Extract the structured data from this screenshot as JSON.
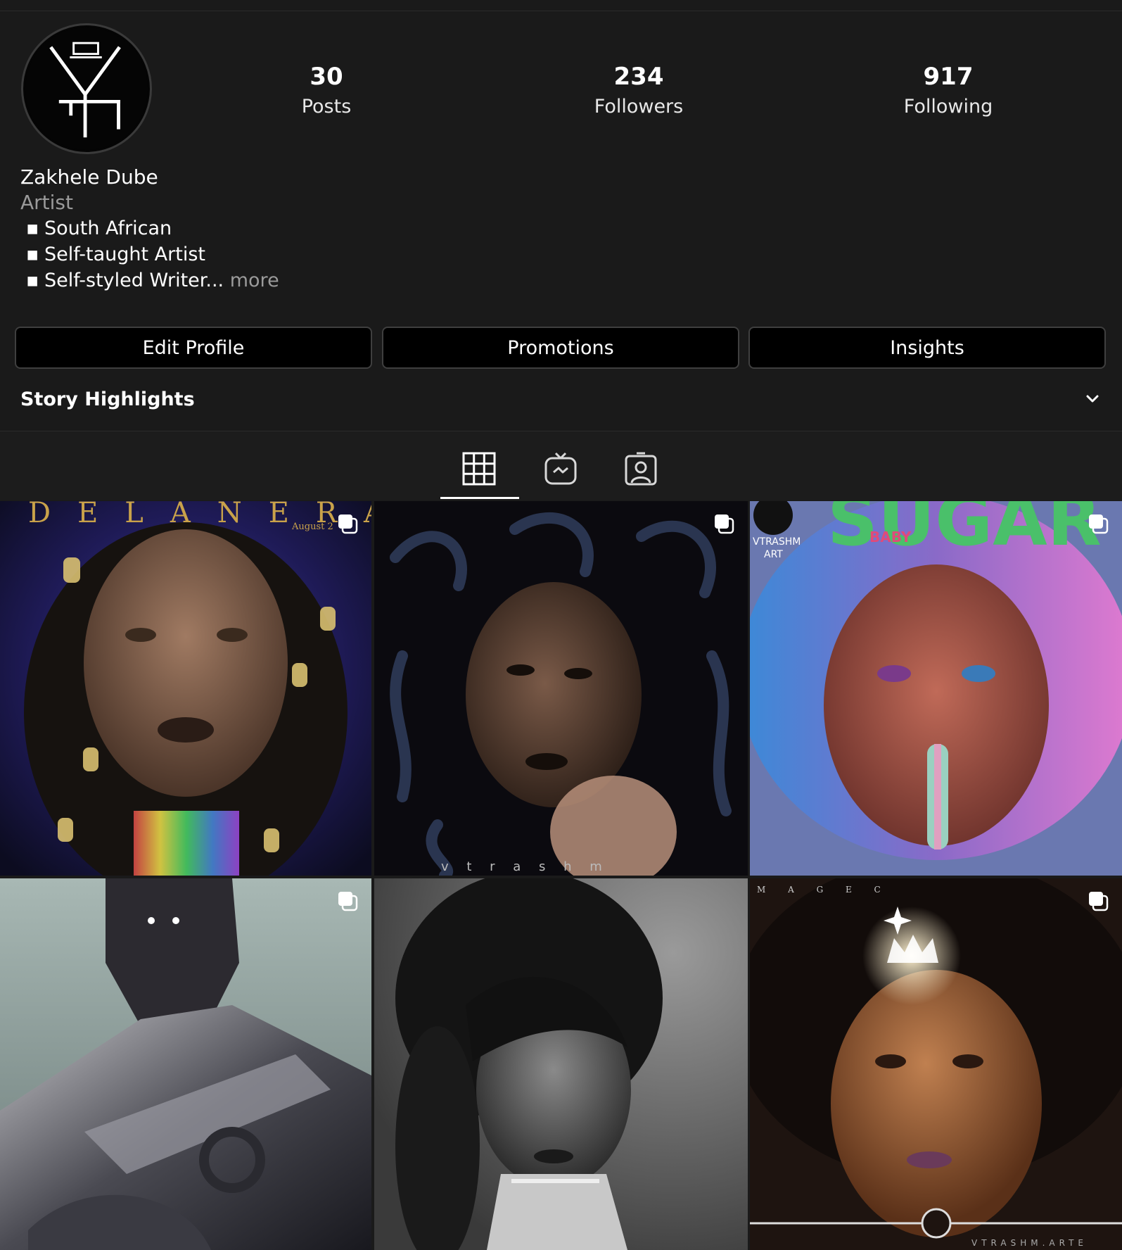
{
  "profile": {
    "name": "Zakhele Dube",
    "category": "Artist",
    "bio": [
      {
        "text": "South African",
        "more": ""
      },
      {
        "text": "Self-taught Artist",
        "more": ""
      },
      {
        "text": "Self-styled Writer...",
        "more": " more"
      }
    ],
    "bullet": "▪",
    "avatar_icon": "vtrashm-logo-icon"
  },
  "stats": {
    "posts": {
      "value": "30",
      "label": "Posts"
    },
    "followers": {
      "value": "234",
      "label": "Followers"
    },
    "following": {
      "value": "917",
      "label": "Following"
    }
  },
  "buttons": {
    "edit_profile": "Edit Profile",
    "promotions": "Promotions",
    "insights": "Insights"
  },
  "highlights": {
    "title": "Story Highlights",
    "toggle_icon": "chevron-down-icon"
  },
  "tabs": [
    {
      "name": "grid",
      "icon": "grid-icon",
      "active": true
    },
    {
      "name": "igtv",
      "icon": "igtv-icon",
      "active": false
    },
    {
      "name": "tagged",
      "icon": "tagged-person-icon",
      "active": false
    }
  ],
  "posts": [
    {
      "id": "post-1",
      "multi": true,
      "overlay_text": "DELANERA",
      "overlay_sub": "August 2"
    },
    {
      "id": "post-2",
      "multi": true,
      "overlay_text": "v  t  r  a  s  h  m"
    },
    {
      "id": "post-3",
      "multi": true,
      "overlay_text": "SUGAR",
      "overlay_sub": "BABY",
      "corner_text": "VTRASHM ART"
    },
    {
      "id": "post-4",
      "multi": true
    },
    {
      "id": "post-5",
      "multi": false
    },
    {
      "id": "post-6",
      "multi": true,
      "overlay_text": "M  A  G  E  C",
      "footer_text": "VTRASHM.ARTE"
    }
  ],
  "colors": {
    "background": "#1a1a1a",
    "button_bg": "#000000",
    "muted_text": "#9a9a9a"
  }
}
